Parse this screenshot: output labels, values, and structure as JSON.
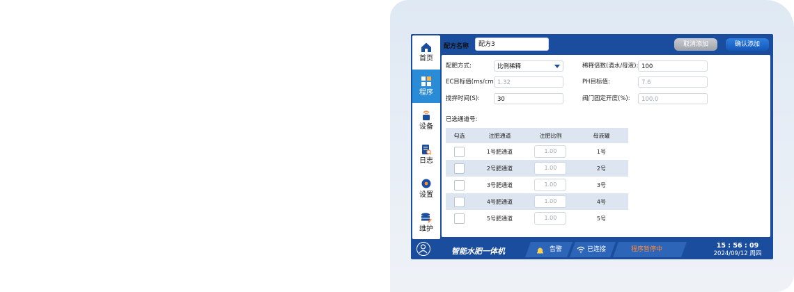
{
  "app": {
    "name": "智能水肥一体机"
  },
  "sidebar": {
    "items": [
      {
        "label": "首页",
        "icon": "home-icon"
      },
      {
        "label": "程序",
        "icon": "program-icon",
        "active": true
      },
      {
        "label": "设备",
        "icon": "device-icon"
      },
      {
        "label": "日志",
        "icon": "log-icon"
      },
      {
        "label": "设置",
        "icon": "settings-icon"
      },
      {
        "label": "维护",
        "icon": "maintenance-icon"
      }
    ]
  },
  "topbar": {
    "name_label": "配方名称",
    "name_value": "配方3",
    "cancel_label": "取消添加",
    "confirm_label": "确认添加"
  },
  "form": {
    "mix_mode_label": "配肥方式:",
    "mix_mode_value": "比例稀释",
    "dilution_label": "稀释倍数(清水/母液):",
    "dilution_value": "100",
    "ec_label": "EC目标值(ms/cm):",
    "ec_value": "1.32",
    "ph_label": "PH目标值:",
    "ph_value": "7.6",
    "stir_label": "搅拌时间(S):",
    "stir_value": "30",
    "valve_label": "阀门固定开度(%):",
    "valve_value": "100.0",
    "channels_label": "已选通道号:"
  },
  "channel_table": {
    "headers": [
      "勾选",
      "注肥通道",
      "注肥比例",
      "母液罐"
    ],
    "rows": [
      {
        "channel": "1号肥通道",
        "ratio": "1.00",
        "tank": "1号",
        "checked": false
      },
      {
        "channel": "2号肥通道",
        "ratio": "1.00",
        "tank": "2号",
        "checked": false
      },
      {
        "channel": "3号肥通道",
        "ratio": "1.00",
        "tank": "3号",
        "checked": false
      },
      {
        "channel": "4号肥通道",
        "ratio": "1.00",
        "tank": "4号",
        "checked": false
      },
      {
        "channel": "5号肥通道",
        "ratio": "1.00",
        "tank": "5号",
        "checked": false
      }
    ]
  },
  "statusbar": {
    "alarm_label": "告警",
    "connection_label": "已连接",
    "program_status": "程序暂停中",
    "time": "15 : 56 : 09",
    "date": "2024/09/12  周四"
  },
  "colors": {
    "frame": "#1b4d9e",
    "active_nav": "#2a8cd6",
    "accent_button": "#1357b8",
    "status_warning": "#ff8a3d"
  }
}
